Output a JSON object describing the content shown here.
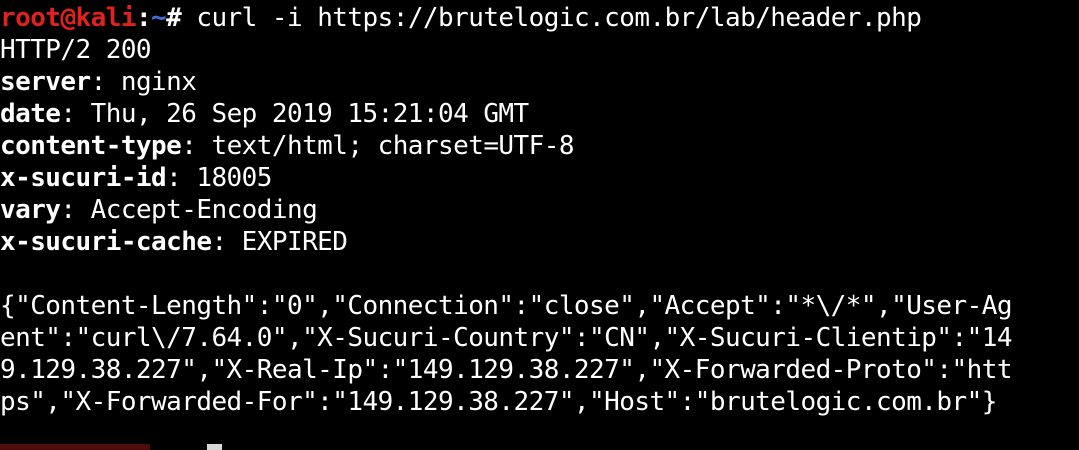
{
  "prompt": {
    "user_host": "root@kali",
    "separator": ":",
    "path": "~",
    "symbol": "#",
    "command": " curl -i https://brutelogic.com.br/lab/header.php"
  },
  "response": {
    "status": "HTTP/2 200",
    "headers": [
      {
        "name": "server",
        "value": " nginx"
      },
      {
        "name": "date",
        "value": " Thu, 26 Sep 2019 15:21:04 GMT"
      },
      {
        "name": "content-type",
        "value": " text/html; charset=UTF-8"
      },
      {
        "name": "x-sucuri-id",
        "value": " 18005"
      },
      {
        "name": "vary",
        "value": " Accept-Encoding"
      },
      {
        "name": "x-sucuri-cache",
        "value": " EXPIRED"
      }
    ],
    "body_lines": [
      "{\"Content-Length\":\"0\",\"Connection\":\"close\",\"Accept\":\"*\\/*\",\"User-Ag",
      "ent\":\"curl\\/7.64.0\",\"X-Sucuri-Country\":\"CN\",\"X-Sucuri-Clientip\":\"14",
      "9.129.38.227\",\"X-Real-Ip\":\"149.129.38.227\",\"X-Forwarded-Proto\":\"htt",
      "ps\",\"X-Forwarded-For\":\"149.129.38.227\",\"Host\":\"brutelogic.com.br\"}"
    ]
  },
  "colors": {
    "background": "#000000",
    "text": "#ffffff",
    "prompt_user": "#e0221f",
    "prompt_path": "#3d6fd6"
  }
}
